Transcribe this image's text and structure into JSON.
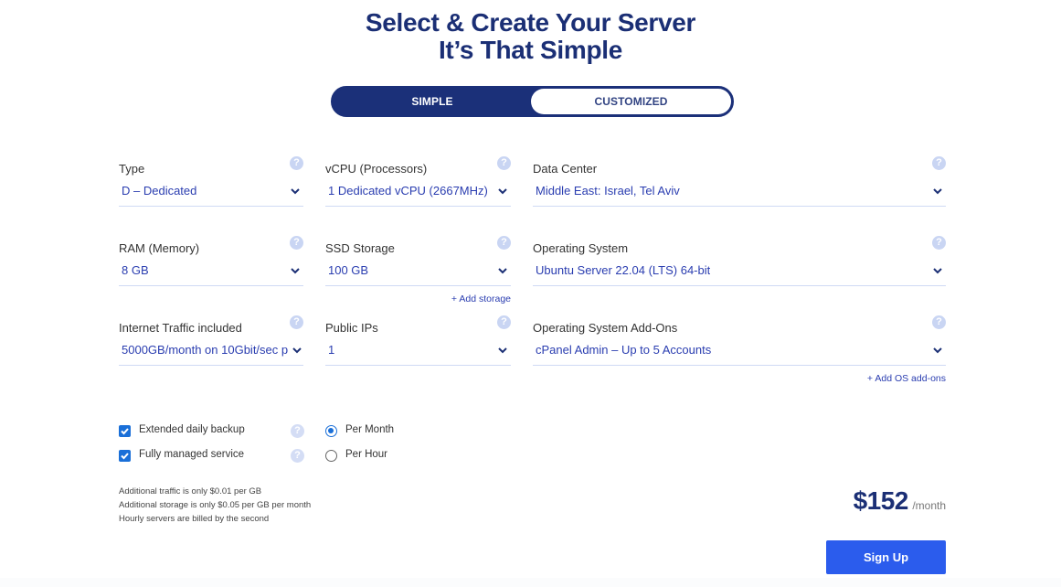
{
  "header": {
    "title_line1": "Select & Create Your Server",
    "title_line2": "It’s That Simple"
  },
  "mode_toggle": {
    "options": [
      "SIMPLE",
      "CUSTOMIZED"
    ],
    "selected": "SIMPLE"
  },
  "fields": {
    "type": {
      "label": "Type",
      "value": "D – Dedicated"
    },
    "vcpu": {
      "label": "vCPU (Processors)",
      "value": "1 Dedicated vCPU (2667MHz)"
    },
    "data_center": {
      "label": "Data Center",
      "value": "Middle East: Israel, Tel Aviv"
    },
    "ram": {
      "label": "RAM (Memory)",
      "value": "8 GB"
    },
    "ssd": {
      "label": "SSD Storage",
      "value": "100 GB"
    },
    "os": {
      "label": "Operating System",
      "value": "Ubuntu Server 22.04 (LTS) 64-bit"
    },
    "traffic": {
      "label": "Internet Traffic included",
      "value": "5000GB/month on 10Gbit/sec p"
    },
    "public_ips": {
      "label": "Public IPs",
      "value": "1"
    },
    "os_addons": {
      "label": "Operating System Add-Ons",
      "value": "cPanel Admin – Up to 5 Accounts"
    }
  },
  "links": {
    "add_storage": "+ Add storage",
    "add_os_addons": "+ Add OS add-ons"
  },
  "help_icon_glyph": "?",
  "options": {
    "backup": {
      "label": "Extended daily backup",
      "checked": true
    },
    "managed": {
      "label": "Fully managed service",
      "checked": true
    }
  },
  "billing": {
    "per_month": {
      "label": "Per Month",
      "selected": true
    },
    "per_hour": {
      "label": "Per Hour",
      "selected": false
    }
  },
  "notes": [
    "Additional traffic is only $0.01 per GB",
    "Additional storage is only $0.05 per GB per month",
    "Hourly servers are billed by the second"
  ],
  "price": {
    "amount": "$152",
    "period": "/month"
  },
  "signup_label": "Sign Up",
  "colors": {
    "brand_navy": "#1b2f75",
    "value_blue": "#2a3db0",
    "button_blue": "#2b5ced",
    "check_blue": "#1a6fd8"
  }
}
